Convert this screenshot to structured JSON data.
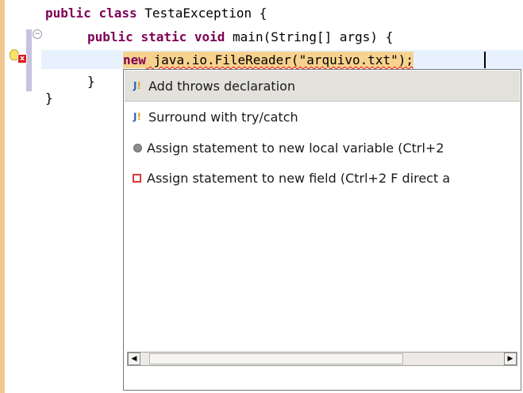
{
  "editor": {
    "lines": [
      {
        "kw1": "public",
        "kw2": "class",
        "rest": " TestaException {"
      },
      {
        "kw1": "public",
        "kw2": "static",
        "kw3": "void",
        "rest": " main(String[] args) {"
      },
      {
        "kw": "new",
        "rest": " java.io.FileReader(\"arquivo.txt\");"
      },
      {
        "text": "}"
      },
      {
        "text": "}"
      }
    ],
    "gutter_icons": [
      "fold-collapse-icon",
      "lightbulb-icon",
      "error-icon"
    ]
  },
  "quickfix": {
    "items": [
      {
        "label": "Add throws declaration",
        "icon": "java-warning-icon",
        "selected": true
      },
      {
        "label": "Surround with try/catch",
        "icon": "java-warning-icon"
      },
      {
        "label": "Assign statement to new local variable (Ctrl+2",
        "icon": "local-variable-icon"
      },
      {
        "label": "Assign statement to new field (Ctrl+2 F direct a",
        "icon": "field-icon"
      }
    ],
    "scrollbar": {
      "left_arrow": "◀",
      "right_arrow": "▶"
    }
  },
  "colors": {
    "keyword": "#7f0055",
    "selection": "#e3e1dc",
    "expression_highlight": "#f7d28f",
    "error": "#e01717"
  }
}
